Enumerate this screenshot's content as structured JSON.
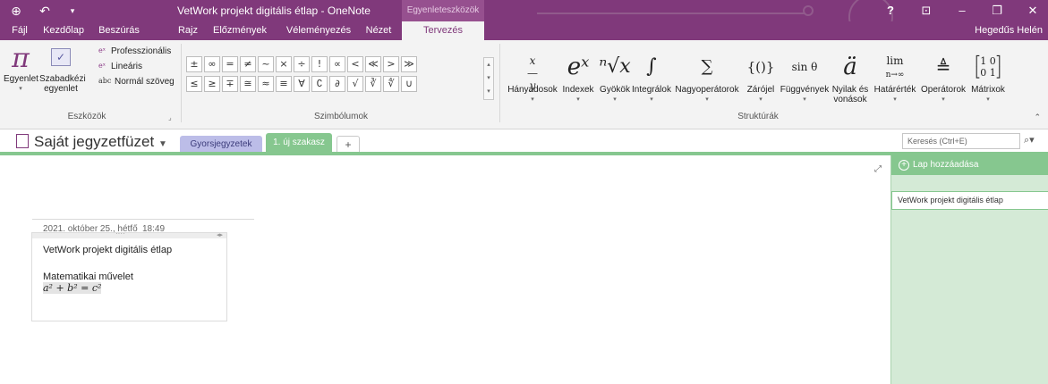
{
  "titlebar": {
    "app_title": "VetWork projekt digitális étlap - OneNote",
    "context_group": "Egyenleteszközök",
    "back_icon": "back-circle-icon",
    "undo_icon": "undo-icon",
    "help": "?",
    "ribbon_display": "⊡",
    "minimize": "–",
    "restore": "❐",
    "close": "✕"
  },
  "tabs": [
    {
      "label": "Fájl"
    },
    {
      "label": "Kezdőlap"
    },
    {
      "label": "Beszúrás"
    },
    {
      "label": "Rajz"
    },
    {
      "label": "Előzmények"
    },
    {
      "label": "Véleményezés"
    },
    {
      "label": "Nézet"
    },
    {
      "label": "Tervezés"
    }
  ],
  "user_name": "Hegedűs Helén",
  "tools_group": {
    "label": "Eszközök",
    "equation": "Egyenlet",
    "freehand": [
      "Szabadkézi",
      "egyenlet"
    ],
    "professional": "Professzionális",
    "linear": "Lineáris",
    "normal_text": "Normál szöveg"
  },
  "symbols_group": {
    "label": "Szimbólumok",
    "row1": [
      "±",
      "∞",
      "=",
      "≠",
      "~",
      "×",
      "÷",
      "!",
      "∝",
      "<",
      "≪",
      ">",
      "≫"
    ],
    "row2": [
      "≤",
      "≥",
      "∓",
      "≅",
      "≈",
      "≡",
      "∀",
      "∁",
      "∂",
      "√",
      "∛",
      "∜",
      "∪"
    ]
  },
  "structures_group": {
    "label": "Struktúrák",
    "items": [
      {
        "label": "Hányadosok",
        "glyph": "x/y"
      },
      {
        "label": "Indexek",
        "glyph": "eˣ"
      },
      {
        "label": "Gyökök",
        "glyph": "ⁿ√x"
      },
      {
        "label": "Integrálok",
        "glyph": "∫"
      },
      {
        "label": "Nagyoperátorok",
        "glyph": "∑"
      },
      {
        "label": "Zárójel",
        "glyph": "{()}"
      },
      {
        "label": "Függvények",
        "glyph": "sin θ"
      },
      {
        "label": "Nyilak és vonások",
        "glyph": "ä"
      },
      {
        "label": "Határérték",
        "glyph": "lim"
      },
      {
        "label": "Operátorok",
        "glyph": "≜"
      },
      {
        "label": "Mátrixok",
        "glyph": "[10 01]"
      }
    ]
  },
  "notebook": {
    "title": "Saját jegyzetfüzet",
    "sections": [
      "Gyorsjegyzetek",
      "1. új szakasz"
    ],
    "add_section": "+"
  },
  "search": {
    "placeholder": "Keresés (Ctrl+E)"
  },
  "page": {
    "date": "2021. október 25., hétfő",
    "time": "18:49",
    "note_title": "VetWork projekt digitális étlap",
    "note_line": "Matematikai művelet",
    "equation": "a² + b² = c²"
  },
  "page_panel": {
    "add_page": "Lap hozzáadása",
    "pages": [
      "VetWork projekt digitális étlap"
    ]
  },
  "colors": {
    "brand": "#80397b",
    "section_green": "#86c78f",
    "section_blue": "#bcbde8"
  }
}
